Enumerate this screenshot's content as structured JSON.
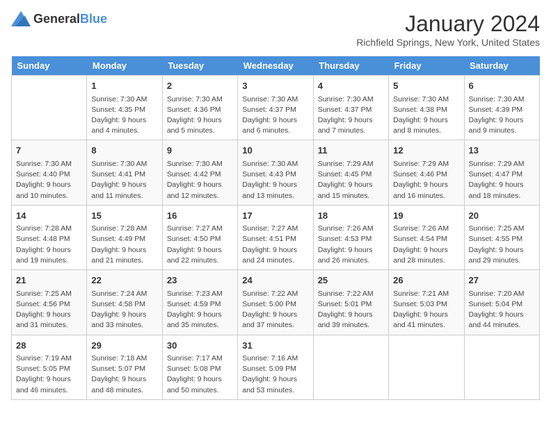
{
  "header": {
    "logo_general": "General",
    "logo_blue": "Blue",
    "month_title": "January 2024",
    "location": "Richfield Springs, New York, United States"
  },
  "days_of_week": [
    "Sunday",
    "Monday",
    "Tuesday",
    "Wednesday",
    "Thursday",
    "Friday",
    "Saturday"
  ],
  "weeks": [
    [
      {
        "date": "",
        "sunrise": "",
        "sunset": "",
        "daylight": ""
      },
      {
        "date": "1",
        "sunrise": "Sunrise: 7:30 AM",
        "sunset": "Sunset: 4:35 PM",
        "daylight": "Daylight: 9 hours and 4 minutes."
      },
      {
        "date": "2",
        "sunrise": "Sunrise: 7:30 AM",
        "sunset": "Sunset: 4:36 PM",
        "daylight": "Daylight: 9 hours and 5 minutes."
      },
      {
        "date": "3",
        "sunrise": "Sunrise: 7:30 AM",
        "sunset": "Sunset: 4:37 PM",
        "daylight": "Daylight: 9 hours and 6 minutes."
      },
      {
        "date": "4",
        "sunrise": "Sunrise: 7:30 AM",
        "sunset": "Sunset: 4:37 PM",
        "daylight": "Daylight: 9 hours and 7 minutes."
      },
      {
        "date": "5",
        "sunrise": "Sunrise: 7:30 AM",
        "sunset": "Sunset: 4:38 PM",
        "daylight": "Daylight: 9 hours and 8 minutes."
      },
      {
        "date": "6",
        "sunrise": "Sunrise: 7:30 AM",
        "sunset": "Sunset: 4:39 PM",
        "daylight": "Daylight: 9 hours and 9 minutes."
      }
    ],
    [
      {
        "date": "7",
        "sunrise": "Sunrise: 7:30 AM",
        "sunset": "Sunset: 4:40 PM",
        "daylight": "Daylight: 9 hours and 10 minutes."
      },
      {
        "date": "8",
        "sunrise": "Sunrise: 7:30 AM",
        "sunset": "Sunset: 4:41 PM",
        "daylight": "Daylight: 9 hours and 11 minutes."
      },
      {
        "date": "9",
        "sunrise": "Sunrise: 7:30 AM",
        "sunset": "Sunset: 4:42 PM",
        "daylight": "Daylight: 9 hours and 12 minutes."
      },
      {
        "date": "10",
        "sunrise": "Sunrise: 7:30 AM",
        "sunset": "Sunset: 4:43 PM",
        "daylight": "Daylight: 9 hours and 13 minutes."
      },
      {
        "date": "11",
        "sunrise": "Sunrise: 7:29 AM",
        "sunset": "Sunset: 4:45 PM",
        "daylight": "Daylight: 9 hours and 15 minutes."
      },
      {
        "date": "12",
        "sunrise": "Sunrise: 7:29 AM",
        "sunset": "Sunset: 4:46 PM",
        "daylight": "Daylight: 9 hours and 16 minutes."
      },
      {
        "date": "13",
        "sunrise": "Sunrise: 7:29 AM",
        "sunset": "Sunset: 4:47 PM",
        "daylight": "Daylight: 9 hours and 18 minutes."
      }
    ],
    [
      {
        "date": "14",
        "sunrise": "Sunrise: 7:28 AM",
        "sunset": "Sunset: 4:48 PM",
        "daylight": "Daylight: 9 hours and 19 minutes."
      },
      {
        "date": "15",
        "sunrise": "Sunrise: 7:28 AM",
        "sunset": "Sunset: 4:49 PM",
        "daylight": "Daylight: 9 hours and 21 minutes."
      },
      {
        "date": "16",
        "sunrise": "Sunrise: 7:27 AM",
        "sunset": "Sunset: 4:50 PM",
        "daylight": "Daylight: 9 hours and 22 minutes."
      },
      {
        "date": "17",
        "sunrise": "Sunrise: 7:27 AM",
        "sunset": "Sunset: 4:51 PM",
        "daylight": "Daylight: 9 hours and 24 minutes."
      },
      {
        "date": "18",
        "sunrise": "Sunrise: 7:26 AM",
        "sunset": "Sunset: 4:53 PM",
        "daylight": "Daylight: 9 hours and 26 minutes."
      },
      {
        "date": "19",
        "sunrise": "Sunrise: 7:26 AM",
        "sunset": "Sunset: 4:54 PM",
        "daylight": "Daylight: 9 hours and 28 minutes."
      },
      {
        "date": "20",
        "sunrise": "Sunrise: 7:25 AM",
        "sunset": "Sunset: 4:55 PM",
        "daylight": "Daylight: 9 hours and 29 minutes."
      }
    ],
    [
      {
        "date": "21",
        "sunrise": "Sunrise: 7:25 AM",
        "sunset": "Sunset: 4:56 PM",
        "daylight": "Daylight: 9 hours and 31 minutes."
      },
      {
        "date": "22",
        "sunrise": "Sunrise: 7:24 AM",
        "sunset": "Sunset: 4:58 PM",
        "daylight": "Daylight: 9 hours and 33 minutes."
      },
      {
        "date": "23",
        "sunrise": "Sunrise: 7:23 AM",
        "sunset": "Sunset: 4:59 PM",
        "daylight": "Daylight: 9 hours and 35 minutes."
      },
      {
        "date": "24",
        "sunrise": "Sunrise: 7:22 AM",
        "sunset": "Sunset: 5:00 PM",
        "daylight": "Daylight: 9 hours and 37 minutes."
      },
      {
        "date": "25",
        "sunrise": "Sunrise: 7:22 AM",
        "sunset": "Sunset: 5:01 PM",
        "daylight": "Daylight: 9 hours and 39 minutes."
      },
      {
        "date": "26",
        "sunrise": "Sunrise: 7:21 AM",
        "sunset": "Sunset: 5:03 PM",
        "daylight": "Daylight: 9 hours and 41 minutes."
      },
      {
        "date": "27",
        "sunrise": "Sunrise: 7:20 AM",
        "sunset": "Sunset: 5:04 PM",
        "daylight": "Daylight: 9 hours and 44 minutes."
      }
    ],
    [
      {
        "date": "28",
        "sunrise": "Sunrise: 7:19 AM",
        "sunset": "Sunset: 5:05 PM",
        "daylight": "Daylight: 9 hours and 46 minutes."
      },
      {
        "date": "29",
        "sunrise": "Sunrise: 7:18 AM",
        "sunset": "Sunset: 5:07 PM",
        "daylight": "Daylight: 9 hours and 48 minutes."
      },
      {
        "date": "30",
        "sunrise": "Sunrise: 7:17 AM",
        "sunset": "Sunset: 5:08 PM",
        "daylight": "Daylight: 9 hours and 50 minutes."
      },
      {
        "date": "31",
        "sunrise": "Sunrise: 7:16 AM",
        "sunset": "Sunset: 5:09 PM",
        "daylight": "Daylight: 9 hours and 53 minutes."
      },
      {
        "date": "",
        "sunrise": "",
        "sunset": "",
        "daylight": ""
      },
      {
        "date": "",
        "sunrise": "",
        "sunset": "",
        "daylight": ""
      },
      {
        "date": "",
        "sunrise": "",
        "sunset": "",
        "daylight": ""
      }
    ]
  ]
}
